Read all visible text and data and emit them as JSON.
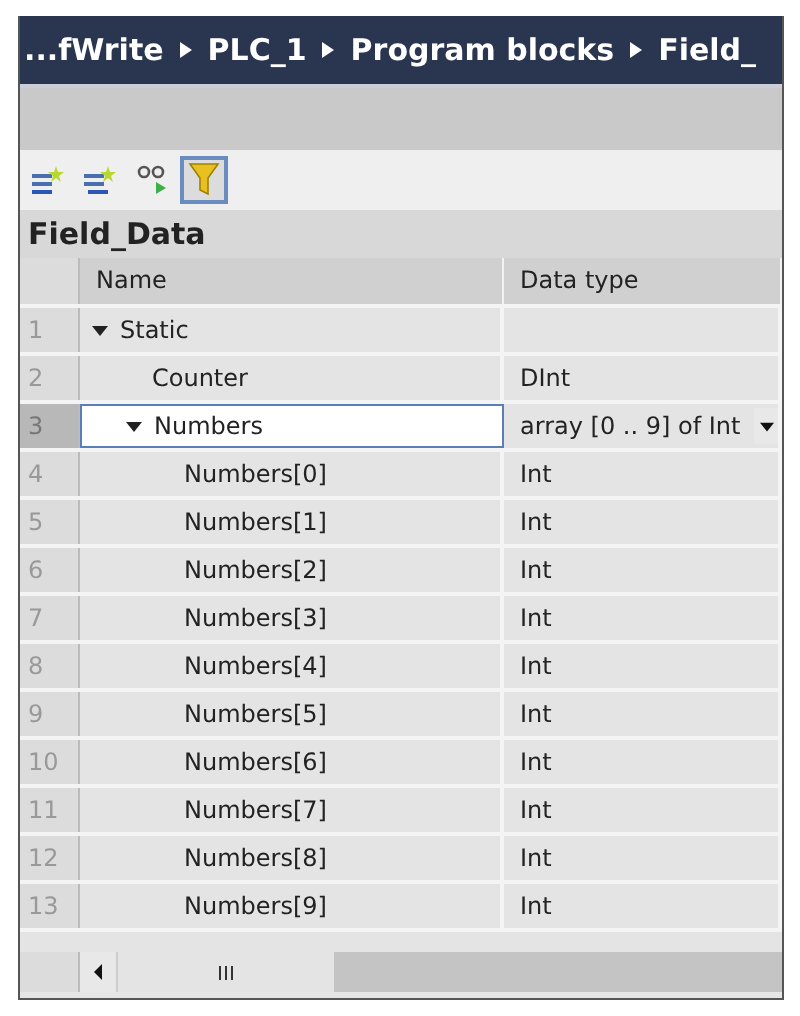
{
  "breadcrumb": [
    "...fWrite",
    "PLC_1",
    "Program blocks",
    "Field_"
  ],
  "toolbar": [
    {
      "kind": "insert-row",
      "selected": false
    },
    {
      "kind": "add-row",
      "selected": false
    },
    {
      "kind": "monitor",
      "selected": false
    },
    {
      "kind": "filter",
      "selected": true
    }
  ],
  "block_title": "Field_Data",
  "table": {
    "columns": [
      "Name",
      "Data type"
    ],
    "rows": [
      {
        "number": "1",
        "name": "Static",
        "data_type": "",
        "expanded": true,
        "selected": false,
        "children": [
          {
            "number": "2",
            "name": "Counter",
            "data_type": "DInt",
            "selected": false
          },
          {
            "number": "3",
            "name": "Numbers",
            "data_type": "array [0 .. 9] of Int",
            "expanded": true,
            "selected": true,
            "children": [
              {
                "number": "4",
                "name": "Numbers[0]",
                "data_type": "Int",
                "selected": false
              },
              {
                "number": "5",
                "name": "Numbers[1]",
                "data_type": "Int",
                "selected": false
              },
              {
                "number": "6",
                "name": "Numbers[2]",
                "data_type": "Int",
                "selected": false
              },
              {
                "number": "7",
                "name": "Numbers[3]",
                "data_type": "Int",
                "selected": false
              },
              {
                "number": "8",
                "name": "Numbers[4]",
                "data_type": "Int",
                "selected": false
              },
              {
                "number": "9",
                "name": "Numbers[5]",
                "data_type": "Int",
                "selected": false
              },
              {
                "number": "10",
                "name": "Numbers[6]",
                "data_type": "Int",
                "selected": false
              },
              {
                "number": "11",
                "name": "Numbers[7]",
                "data_type": "Int",
                "selected": false
              },
              {
                "number": "12",
                "name": "Numbers[8]",
                "data_type": "Int",
                "selected": false
              },
              {
                "number": "13",
                "name": "Numbers[9]",
                "data_type": "Int",
                "selected": false
              }
            ]
          }
        ]
      }
    ]
  }
}
